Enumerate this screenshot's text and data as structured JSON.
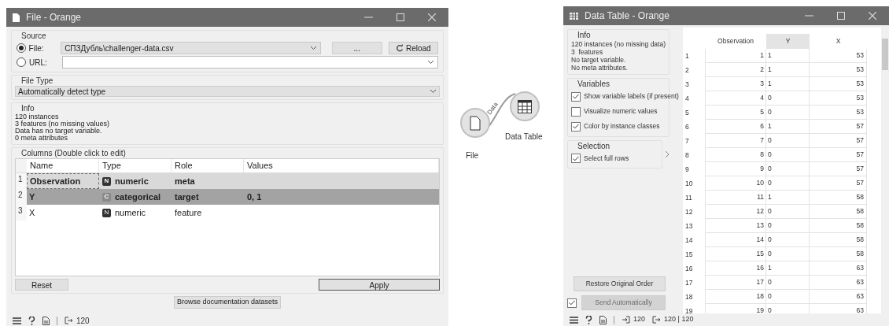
{
  "file_window": {
    "title": "File - Orange",
    "source": {
      "label": "Source",
      "options": [
        {
          "label": "File:",
          "selected": true,
          "value": "СПЗДубль\\challenger-data.csv",
          "kind": "combo"
        },
        {
          "label": "URL:",
          "selected": false,
          "kind": "editable"
        }
      ],
      "browse": "...",
      "reload": "Reload"
    },
    "file_type": {
      "label": "File Type",
      "value": "Automatically detect type"
    },
    "info": {
      "label": "Info",
      "lines": [
        "120 instances",
        "3 features (no missing values)",
        "Data has no target variable.",
        "0 meta attributes"
      ]
    },
    "columns": {
      "label": "Columns (Double click to edit)",
      "headers": [
        "Name",
        "Type",
        "Role",
        "Values"
      ],
      "rows": [
        {
          "index": "1",
          "name": "Observation",
          "badge": "N",
          "type": "numeric",
          "role": "meta",
          "values": "",
          "selected": false,
          "focused": true
        },
        {
          "index": "2",
          "name": "Y",
          "badge": "C",
          "type": "categorical",
          "role": "target",
          "values": "0, 1",
          "selected": true,
          "focused": false
        },
        {
          "index": "3",
          "name": "X",
          "badge": "N",
          "type": "numeric",
          "role": "feature",
          "values": "",
          "selected": false,
          "focused": false
        }
      ],
      "reset": "Reset",
      "apply": "Apply"
    },
    "browse_docs": "Browse documentation datasets",
    "status": {
      "output_count": "120"
    }
  },
  "canvas": {
    "nodes": [
      {
        "label": "File",
        "kind": "file"
      },
      {
        "label": "Data Table",
        "kind": "table"
      }
    ],
    "link_label": "Data"
  },
  "table_window": {
    "title": "Data Table - Orange",
    "info": {
      "label": "Info",
      "lines": [
        "120 instances (no missing data)",
        "3  features",
        "No target variable.",
        "No meta attributes."
      ]
    },
    "variables": {
      "label": "Variables",
      "options": [
        {
          "label": "Show variable labels (if present)",
          "checked": true
        },
        {
          "label": "Visualize numeric values",
          "checked": false
        },
        {
          "label": "Color by instance classes",
          "checked": true
        }
      ]
    },
    "selection": {
      "label": "Selection",
      "options": [
        {
          "label": "Select full rows",
          "checked": true
        }
      ]
    },
    "restore": "Restore Original Order",
    "send_auto": {
      "label": "Send Automatically",
      "checked": true,
      "disabled": true
    },
    "headers": [
      {
        "label": "Observation",
        "selected": false
      },
      {
        "label": "Y",
        "selected": true
      },
      {
        "label": "X",
        "selected": false
      }
    ],
    "rows": [
      [
        "1",
        "1",
        "1",
        "53"
      ],
      [
        "2",
        "2",
        "1",
        "53"
      ],
      [
        "3",
        "3",
        "1",
        "53"
      ],
      [
        "4",
        "4",
        "0",
        "53"
      ],
      [
        "5",
        "5",
        "0",
        "53"
      ],
      [
        "6",
        "6",
        "1",
        "57"
      ],
      [
        "7",
        "7",
        "0",
        "57"
      ],
      [
        "8",
        "8",
        "0",
        "57"
      ],
      [
        "9",
        "9",
        "0",
        "57"
      ],
      [
        "10",
        "10",
        "0",
        "57"
      ],
      [
        "11",
        "11",
        "1",
        "58"
      ],
      [
        "12",
        "12",
        "0",
        "58"
      ],
      [
        "13",
        "13",
        "0",
        "58"
      ],
      [
        "14",
        "14",
        "0",
        "58"
      ],
      [
        "15",
        "15",
        "0",
        "58"
      ],
      [
        "16",
        "16",
        "1",
        "63"
      ],
      [
        "17",
        "17",
        "0",
        "63"
      ],
      [
        "18",
        "18",
        "0",
        "63"
      ],
      [
        "19",
        "19",
        "0",
        "63"
      ]
    ],
    "status": {
      "input_count": "120",
      "output_count": "120 | 120"
    }
  }
}
